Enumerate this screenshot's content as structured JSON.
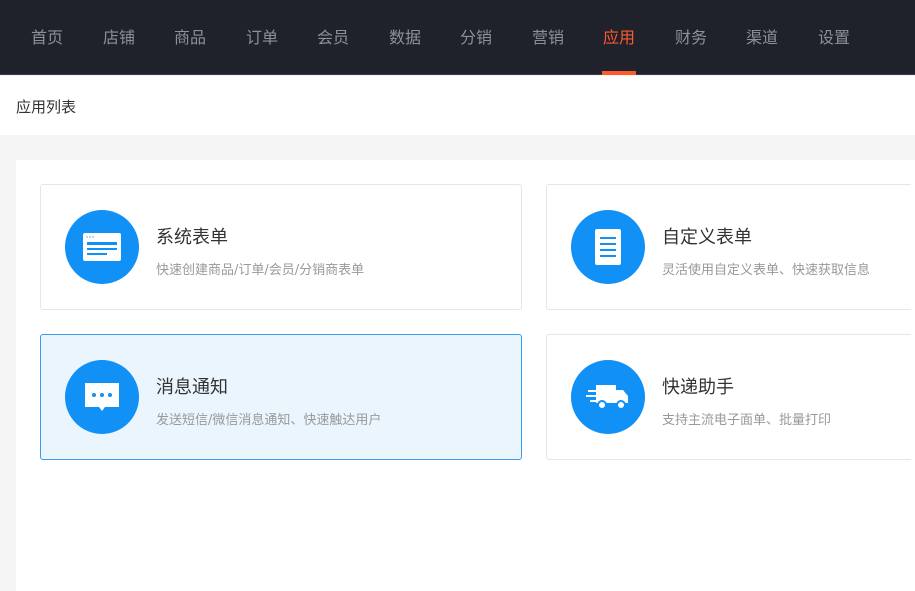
{
  "nav": {
    "items": [
      "首页",
      "店铺",
      "商品",
      "订单",
      "会员",
      "数据",
      "分销",
      "营销",
      "应用",
      "财务",
      "渠道",
      "设置"
    ],
    "active_index": 8,
    "active_color": "#ff5a2e"
  },
  "breadcrumb": {
    "title": "应用列表"
  },
  "cards": [
    {
      "title": "系统表单",
      "desc": "快速创建商品/订单/会员/分销商表单",
      "icon": "form-window-icon"
    },
    {
      "title": "自定义表单",
      "desc": "灵活使用自定义表单、快速获取信息",
      "icon": "document-icon"
    },
    {
      "title": "消息通知",
      "desc": "发送短信/微信消息通知、快速触达用户",
      "icon": "chat-bubble-icon",
      "selected": true
    },
    {
      "title": "快递助手",
      "desc": "支持主流电子面单、批量打印",
      "icon": "delivery-truck-icon"
    }
  ],
  "accent": "#1190f5"
}
